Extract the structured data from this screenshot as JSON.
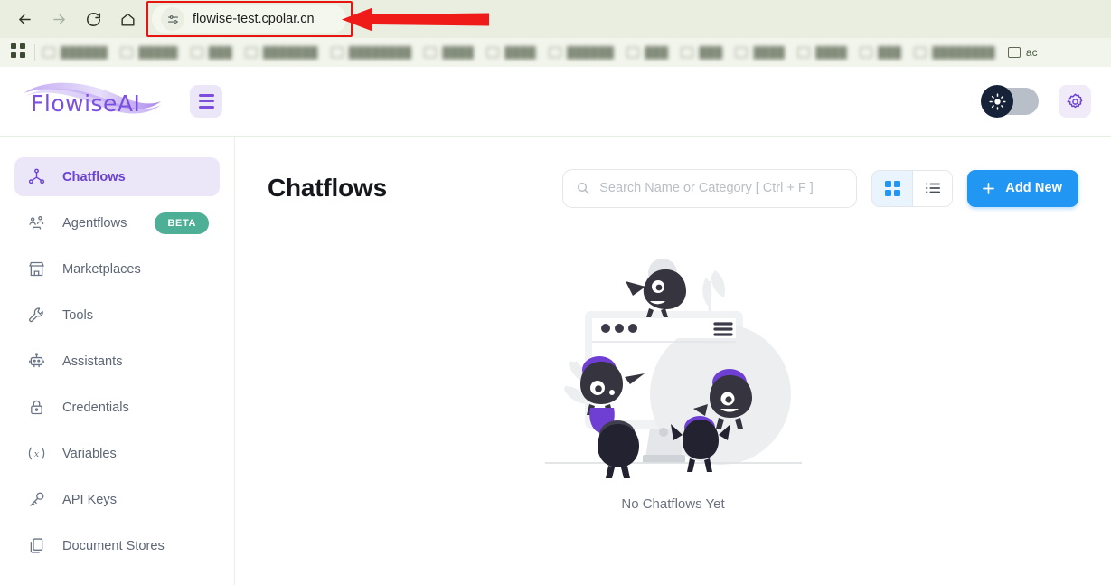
{
  "browser": {
    "back_icon": "arrow-left-icon",
    "forward_icon": "arrow-right-icon",
    "reload_icon": "reload-icon",
    "home_icon": "home-icon",
    "site_info_icon": "site-settings-icon",
    "url": "flowise-test.cpolar.cn",
    "annotation": {
      "highlight_color": "#e8140f",
      "arrow": "red-left-arrow"
    },
    "bookmarks": {
      "apps_icon": "apps-grid-icon",
      "items": [
        {
          "label": "██████"
        },
        {
          "label": "█████"
        },
        {
          "label": "███"
        },
        {
          "label": "███████"
        },
        {
          "label": "████████"
        },
        {
          "label": "████"
        },
        {
          "label": "████"
        },
        {
          "label": "██████"
        },
        {
          "label": "███"
        },
        {
          "label": "███"
        },
        {
          "label": "████"
        },
        {
          "label": "████"
        },
        {
          "label": "███"
        },
        {
          "label": "████████"
        },
        {
          "label": "ac"
        }
      ]
    }
  },
  "header": {
    "logo_text": "FlowiseAI",
    "logo_color": "#7b4fe0",
    "menu_icon": "hamburger-menu-icon",
    "theme_toggle": {
      "icon": "sun-icon",
      "state": "light"
    },
    "settings_icon": "gear-icon"
  },
  "sidebar": {
    "items": [
      {
        "label": "Chatflows",
        "icon": "nodes-graph-icon",
        "active": true,
        "badge": null
      },
      {
        "label": "Agentflows",
        "icon": "agents-icon",
        "active": false,
        "badge": "BETA"
      },
      {
        "label": "Marketplaces",
        "icon": "store-icon",
        "active": false,
        "badge": null
      },
      {
        "label": "Tools",
        "icon": "wrench-icon",
        "active": false,
        "badge": null
      },
      {
        "label": "Assistants",
        "icon": "robot-icon",
        "active": false,
        "badge": null
      },
      {
        "label": "Credentials",
        "icon": "lock-icon",
        "active": false,
        "badge": null
      },
      {
        "label": "Variables",
        "icon": "variable-x-icon",
        "active": false,
        "badge": null
      },
      {
        "label": "API Keys",
        "icon": "key-icon",
        "active": false,
        "badge": null
      },
      {
        "label": "Document Stores",
        "icon": "documents-icon",
        "active": false,
        "badge": null
      }
    ],
    "badge_color": "#4caf96",
    "active_color": "#6b42d4"
  },
  "main": {
    "title": "Chatflows",
    "search": {
      "icon": "search-icon",
      "placeholder": "Search Name or Category [ Ctrl + F ]",
      "value": ""
    },
    "view_toggle": {
      "grid_icon": "grid-view-icon",
      "list_icon": "list-view-icon",
      "selected": "grid"
    },
    "add_new": {
      "icon": "plus-icon",
      "label": "Add New",
      "color": "#2196f3"
    },
    "empty_state": {
      "illustration": "monsters-monitor-empty-illustration",
      "text": "No Chatflows Yet"
    }
  }
}
